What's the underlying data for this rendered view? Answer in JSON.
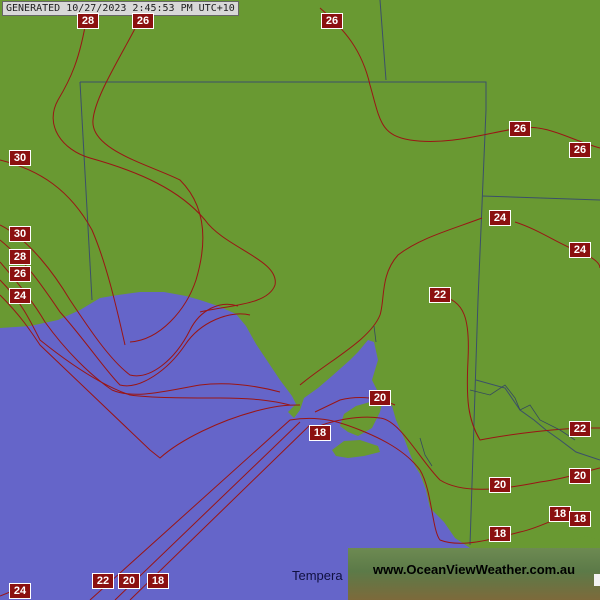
{
  "generated_stamp": "GENERATED 10/27/2023 2:45:53 PM UTC+10",
  "legend_title_partial": "Tempera",
  "brand_url": "www.OceanViewWeather.com.au",
  "colors": {
    "ocean": "#6565c9",
    "land": "#699932",
    "isotherm": "#9a1515",
    "border": "#3b4f6a",
    "label_bg": "#8b1010",
    "label_text": "#ffffff"
  },
  "isotherm_labels": {
    "top_28": "28",
    "top_26a": "26",
    "top_26b": "26",
    "ne_26a": "26",
    "ne_26b": "26",
    "w_30a": "30",
    "w_30b": "30",
    "w_28": "28",
    "w_26": "26",
    "w_24": "24",
    "e_24a": "24",
    "e_24b": "24",
    "c_22": "22",
    "se_22": "22",
    "gulf_20": "20",
    "se_20a": "20",
    "se_20b": "20",
    "gulf_18": "18",
    "se_18a": "18",
    "se_18b": "18",
    "se_18c": "18",
    "bot_24": "24",
    "bot_22": "22",
    "bot_20": "20",
    "bot_18": "18"
  }
}
